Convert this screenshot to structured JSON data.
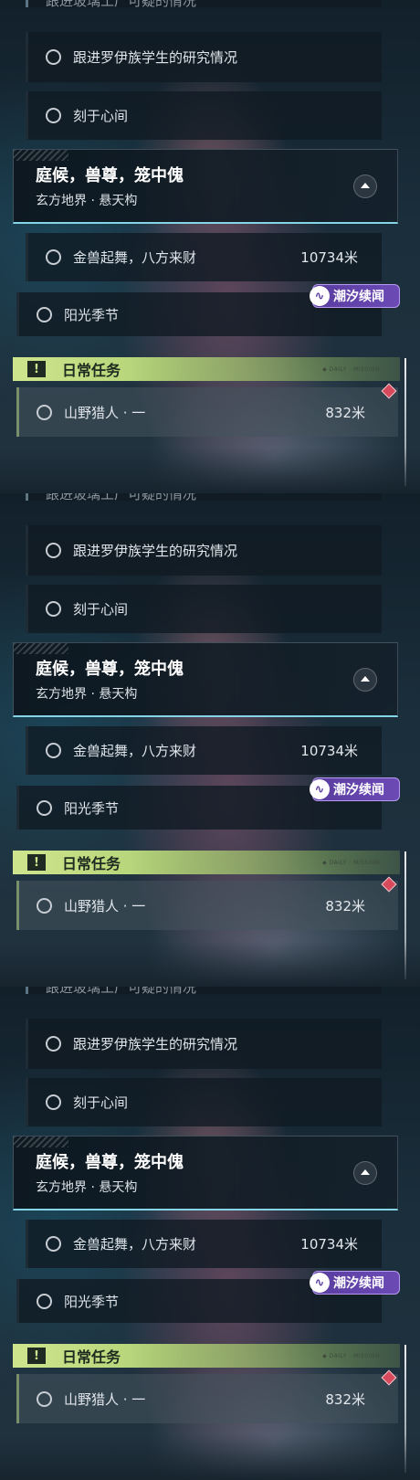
{
  "panels": [
    {
      "cut_top_text": "跟进玻璃工厂可疑的情况",
      "track_items": [
        {
          "label": "跟进罗伊族学生的研究情况"
        },
        {
          "label": "刻于心间"
        }
      ],
      "main_quest": {
        "title": "庭候，兽尊，笼中傀",
        "location": "玄方地界 · 悬天构",
        "steps": [
          {
            "label": "金兽起舞，八方来财",
            "distance": "10734米"
          }
        ]
      },
      "event_badge": {
        "label": "潮汐续闻",
        "icon": "tide-logo-icon"
      },
      "extra_item": {
        "label": "阳光季节"
      },
      "daily": {
        "header": "日常任务",
        "header_icon": "!",
        "tag": "◆ DAILY · MISSION",
        "items": [
          {
            "label": "山野猎人 · 一",
            "distance": "832米"
          }
        ]
      }
    },
    {
      "cut_top_text": "跟进玻璃工厂可疑的情况",
      "track_items": [
        {
          "label": "跟进罗伊族学生的研究情况"
        },
        {
          "label": "刻于心间"
        }
      ],
      "main_quest": {
        "title": "庭候，兽尊，笼中傀",
        "location": "玄方地界 · 悬天构",
        "steps": [
          {
            "label": "金兽起舞，八方来财",
            "distance": "10734米"
          }
        ]
      },
      "event_badge": {
        "label": "潮汐续闻",
        "icon": "tide-logo-icon"
      },
      "extra_item": {
        "label": "阳光季节"
      },
      "daily": {
        "header": "日常任务",
        "header_icon": "!",
        "tag": "◆ DAILY · MISSION",
        "items": [
          {
            "label": "山野猎人 · 一",
            "distance": "832米"
          }
        ]
      }
    },
    {
      "cut_top_text": "跟进玻璃工厂可疑的情况",
      "track_items": [
        {
          "label": "跟进罗伊族学生的研究情况"
        },
        {
          "label": "刻于心间"
        }
      ],
      "main_quest": {
        "title": "庭候，兽尊，笼中傀",
        "location": "玄方地界 · 悬天构",
        "steps": [
          {
            "label": "金兽起舞，八方来财",
            "distance": "10734米"
          }
        ]
      },
      "event_badge": {
        "label": "潮汐续闻",
        "icon": "tide-logo-icon"
      },
      "extra_item": {
        "label": "阳光季节"
      },
      "daily": {
        "header": "日常任务",
        "header_icon": "!",
        "tag": "◆ DAILY · MISSION",
        "items": [
          {
            "label": "山野猎人 · 一",
            "distance": "832米"
          }
        ]
      }
    }
  ],
  "colors": {
    "daily_accent": "#b8d67b",
    "event_purple": "#5a3da0",
    "quest_underline": "#86d5e6",
    "waypoint_red": "#d64a5c"
  }
}
